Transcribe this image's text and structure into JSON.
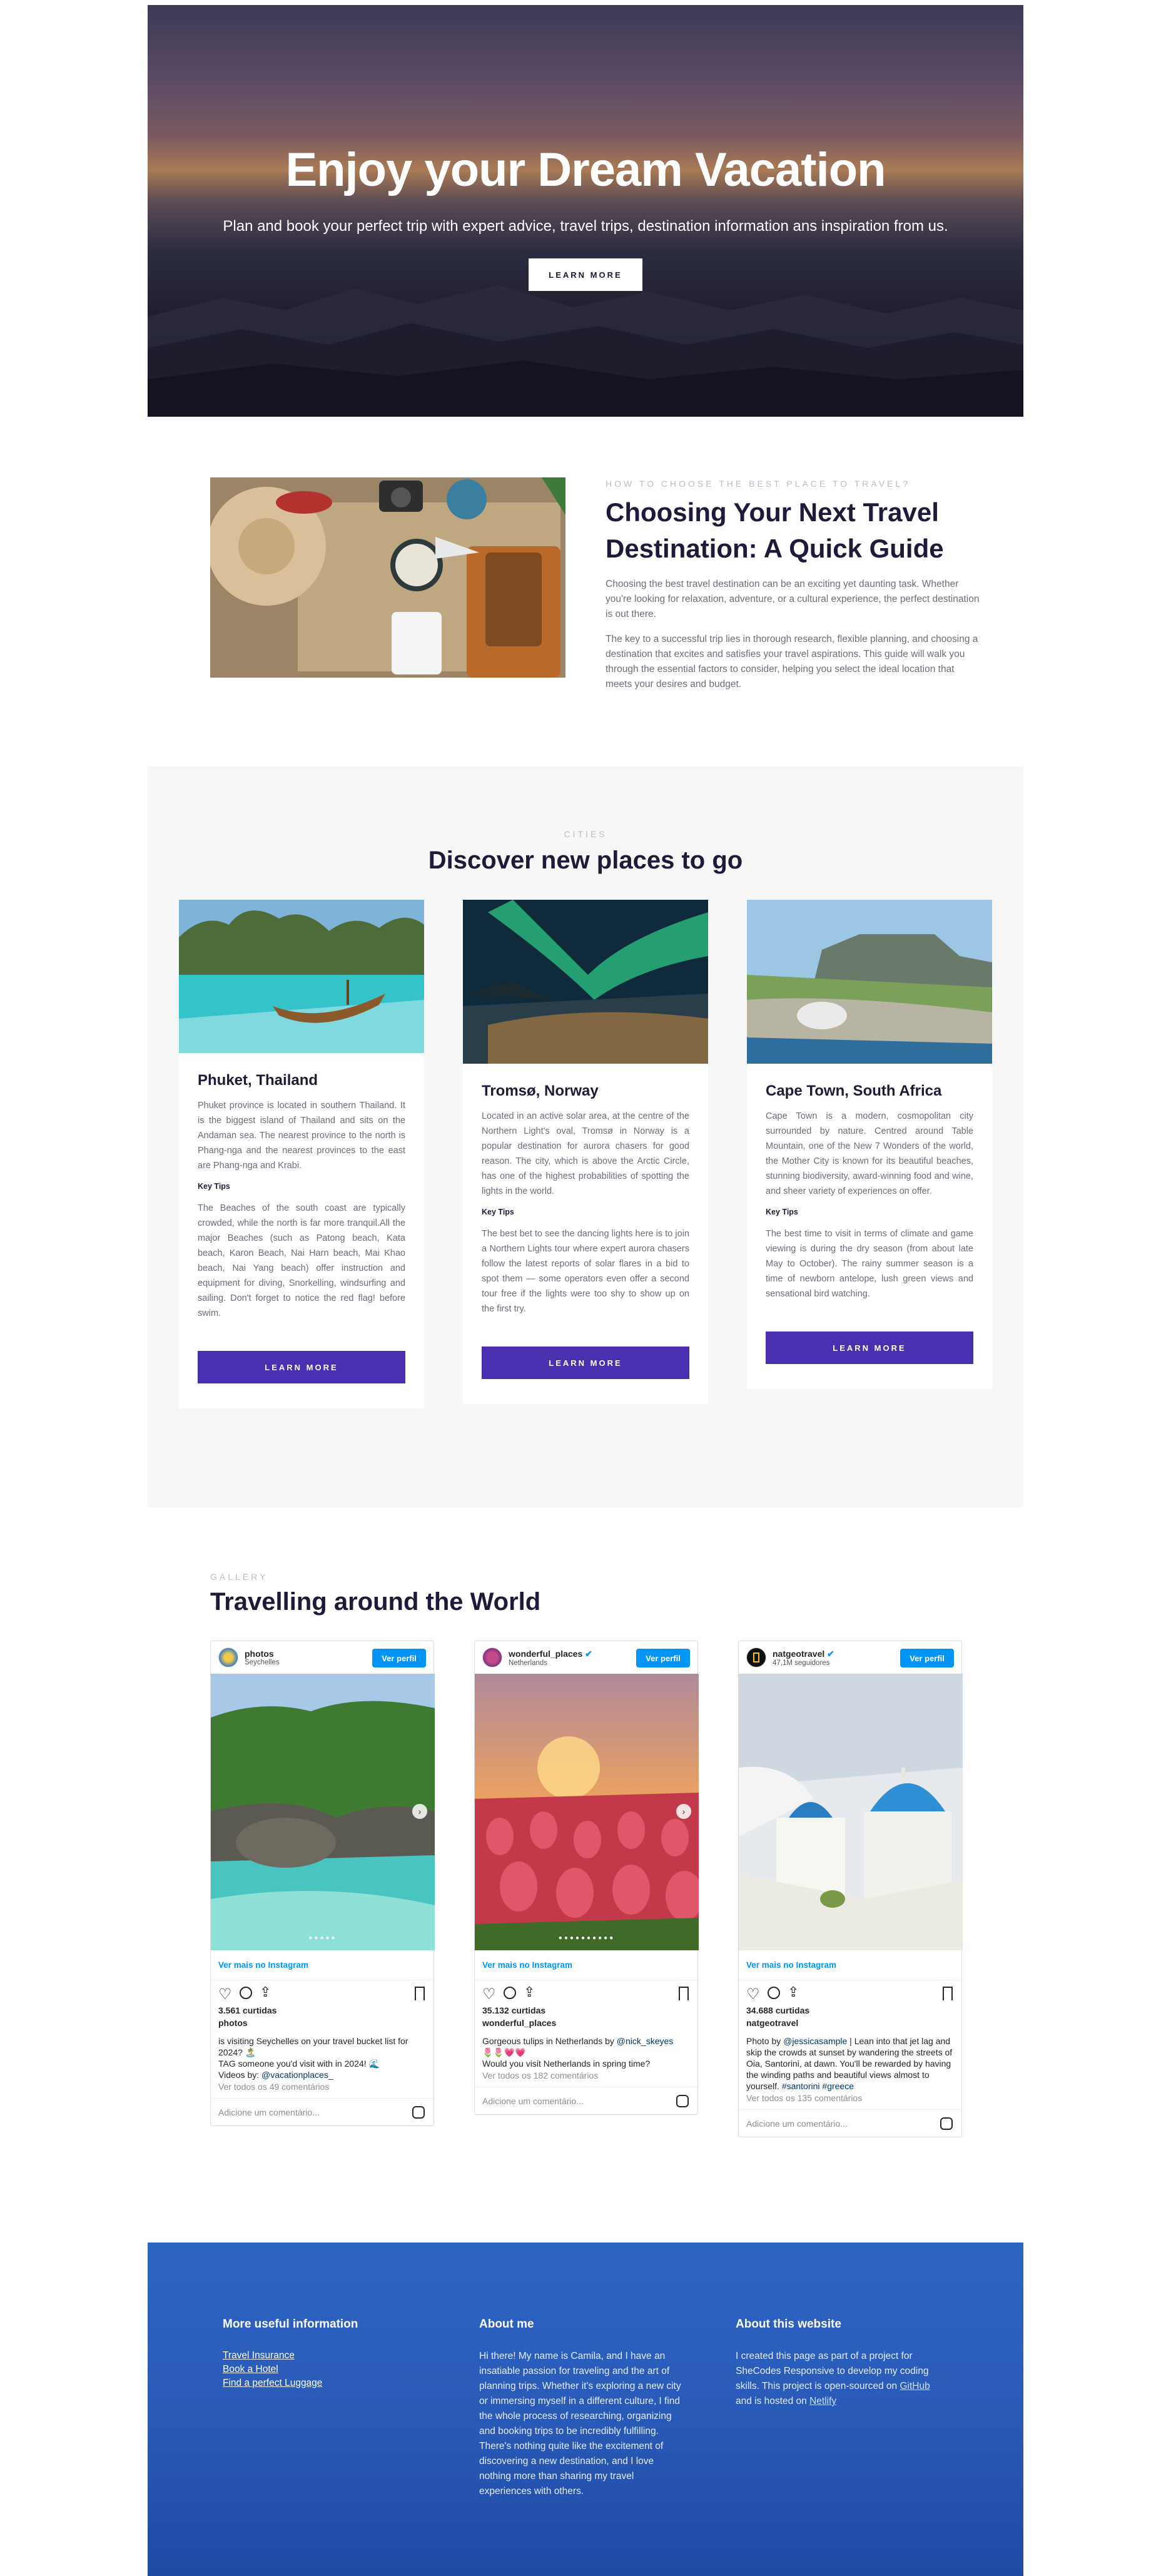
{
  "hero": {
    "title": "Enjoy your Dream Vacation",
    "subtitle": "Plan and book your perfect trip with expert advice, travel trips, destination information ans inspiration from us.",
    "button": "LEARN MORE"
  },
  "guide": {
    "eyebrow": "HOW TO CHOOSE THE BEST PLACE TO TRAVEL?",
    "title": "Choosing Your Next Travel Destination: A Quick Guide",
    "p1": "Choosing the best travel destination can be an exciting yet daunting task. Whether you're looking for relaxation, adventure, or a cultural experience, the perfect destination is out there.",
    "p2": "The key to a successful trip lies in thorough research, flexible planning, and choosing a destination that excites and satisfies your travel aspirations. This guide will walk you through the essential factors to consider, helping you select the ideal location that meets your desires and budget."
  },
  "cities": {
    "eyebrow": "CITIES",
    "title": "Discover new places to go",
    "cards": [
      {
        "name": "Phuket, Thailand",
        "desc": "Phuket province is located in southern Thailand. It is the biggest island of Thailand and sits on the Andaman sea. The nearest province to the north is Phang-nga and the nearest provinces to the east are Phang-nga and Krabi.",
        "tips_label": "Key Tips",
        "tips": "The Beaches of the south coast are typically crowded, while the north is far more tranquil.All the major Beaches (such as Patong beach, Kata beach, Karon Beach, Nai Harn beach, Mai Khao beach, Nai Yang beach) offer instruction and equipment for diving, Snorkelling, windsurfing and sailing. Don't forget to notice the red flag! before swim.",
        "button": "LEARN MORE"
      },
      {
        "name": "Tromsø, Norway",
        "desc": "Located in an active solar area, at the centre of the Northern Light's oval, Tromsø in Norway is a popular destination for aurora chasers for good reason. The city, which is above the Arctic Circle, has one of the highest probabilities of spotting the lights in the world.",
        "tips_label": "Key Tips",
        "tips": "The best bet to see the dancing lights here is to join a Northern Lights tour where expert aurora chasers follow the latest reports of solar flares in a bid to spot them — some operators even offer a second tour free if the lights were too shy to show up on the first try.",
        "button": "LEARN MORE"
      },
      {
        "name": "Cape Town, South Africa",
        "desc": "Cape Town is a modern, cosmopolitan city surrounded by nature. Centred around Table Mountain, one of the New 7 Wonders of the world, the Mother City is known for its beautiful beaches, stunning biodiversity, award-winning food and wine, and sheer variety of experiences on offer.",
        "tips_label": "Key Tips",
        "tips": "The best time to visit in terms of climate and game viewing is during the dry season (from about late May to October). The rainy summer season is a time of newborn antelope, lush green views and sensational bird watching.",
        "button": "LEARN MORE"
      }
    ]
  },
  "gallery": {
    "eyebrow": "GALLERY",
    "title": "Travelling around the World",
    "posts": [
      {
        "user": "photos",
        "sub": "Seychelles",
        "follow": "Ver perfil",
        "more": "Ver mais no Instagram",
        "likes": "3.561 curtidas",
        "cap_user": "photos",
        "caption_l1": "is visiting Seychelles on your travel bucket list for 2024? 🏝️",
        "caption_l2": "TAG someone you'd visit with in 2024! 🌊",
        "caption_l3a": "Videos by: ",
        "caption_l3b": "@vacationplaces_",
        "all_comments": "Ver todos os 49 comentários",
        "comment_ph": "Adicione um comentário..."
      },
      {
        "user": "wonderful_places",
        "sub": "Netherlands",
        "follow": "Ver perfil",
        "more": "Ver mais no Instagram",
        "likes": "35.132 curtidas",
        "cap_user": "wonderful_places",
        "caption_l1a": "Gorgeous tulips in Netherlands by ",
        "caption_l1b": "@nick_skeyes",
        "caption_l2": "🌷🌷💗💗",
        "caption_l3": "Would you visit Netherlands in spring time?",
        "all_comments": "Ver todos os 182 comentários",
        "comment_ph": "Adicione um comentário..."
      },
      {
        "user": "natgeotravel",
        "sub": "47,1M seguidores",
        "follow": "Ver perfil",
        "more": "Ver mais no Instagram",
        "likes": "34.688 curtidas",
        "cap_user": "natgeotravel",
        "caption_a": "Photo by ",
        "caption_b": "@jessicasample",
        "caption_c": " | Lean into that jet lag and skip the crowds at sunset by wandering the streets of Oia, Santorini, at dawn. You'll be rewarded by having the winding paths and beautiful views almost to yourself. ",
        "caption_d": "#santorini #greece",
        "all_comments": "Ver todos os 135 comentários",
        "comment_ph": "Adicione um comentário..."
      }
    ]
  },
  "footer": {
    "col1_title": "More useful information",
    "links": [
      "Travel Insurance",
      "Book a Hotel",
      "Find a perfect Luggage"
    ],
    "col2_title": "About me",
    "about": "Hi there! My name is Camila, and I have an insatiable passion for traveling and the art of planning trips. Whether it's exploring a new city or immersing myself in a different culture, I find the whole process of researching, organizing and booking trips to be incredibly fulfilling. There's nothing quite like the excitement of discovering a new destination, and I love nothing more than sharing my travel experiences with others.",
    "col3_title": "About this website",
    "site_a": "I created this page as part of a project for SheCodes Responsive to develop my coding skills. This project is open-sourced on ",
    "site_github": "GitHub",
    "site_b": " and is hosted on ",
    "site_netlify": "Netlify"
  },
  "colors": {
    "accent": "#4a2fb0",
    "footer": "#2a5ab8",
    "instagram_blue": "#0095f6"
  }
}
